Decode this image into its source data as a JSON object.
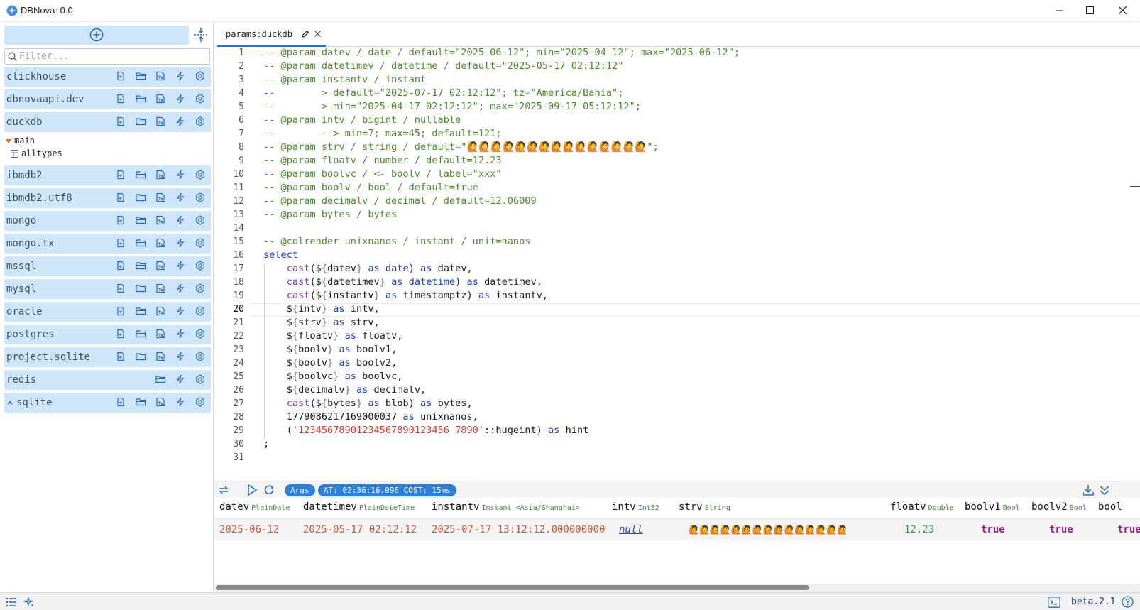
{
  "window": {
    "title": "DBNova: 0.0"
  },
  "sidebar": {
    "filter_placeholder": "Filter...",
    "connections": [
      {
        "label": "clickhouse"
      },
      {
        "label": "dbnovaapi.dev"
      },
      {
        "label": "duckdb"
      },
      {
        "label": "ibmdb2"
      },
      {
        "label": "ibmdb2.utf8"
      },
      {
        "label": "mongo"
      },
      {
        "label": "mongo.tx"
      },
      {
        "label": "mssql"
      },
      {
        "label": "mysql"
      },
      {
        "label": "oracle"
      },
      {
        "label": "postgres"
      },
      {
        "label": "project.sqlite"
      },
      {
        "label": "redis"
      },
      {
        "label": "sqlite"
      }
    ],
    "tree": {
      "schema": "main",
      "table": "alltypes"
    }
  },
  "tab": {
    "label": "params:duckdb"
  },
  "editor": {
    "active_line": 20,
    "lines": [
      "-- @param datev / date / default=\"2025-06-12\"; min=\"2025-04-12\"; max=\"2025-06-12\";",
      "-- @param datetimev / datetime / default=\"2025-05-17 02:12:12\"",
      "-- @param instantv / instant",
      "--        > default=\"2025-07-17 02:12:12\"; tz=\"America/Bahia\";",
      "--        > min=\"2025-04-17 02:12:12\"; max=\"2025-09-17 05:12:12\";",
      "-- @param intv / bigint / nullable",
      "--        - > min=7; max=45; default=121;",
      "-- @param strv / string / default=\"🙋🙋🙋🙋🙋🙋🙋🙋🙋🙋🙋🙋🙋🙋🙋\";",
      "-- @param floatv / number / default=12.23",
      "-- @param boolvc / <- boolv / label=\"xxx\"",
      "-- @param boolv / bool / default=true",
      "-- @param decimalv / decimal / default=12.06009",
      "-- @param bytes / bytes",
      "",
      "-- @colrender unixnanos / instant / unit=nanos",
      "select",
      "    cast(${datev} as date) as datev,",
      "    cast(${datetimev} as datetime) as datetimev,",
      "    cast(${instantv} as timestamptz) as instantv,",
      "    ${intv} as intv,",
      "    ${strv} as strv,",
      "    ${floatv} as floatv,",
      "    ${boolv} as boolv1,",
      "    ${boolv} as boolv2,",
      "    ${boolvc} as boolvc,",
      "    ${decimalv} as decimalv,",
      "    cast(${bytes} as blob) as bytes,",
      "    1779086217169000037 as unixnanos,",
      "    ('12345678901234567890123456 7890'::hugeint) as hint",
      ";",
      ""
    ]
  },
  "results": {
    "args_label": "Args",
    "status": "AT: 02:36:16.096 COST: 15ms",
    "columns": [
      {
        "name": "datev",
        "type": "PlainDate"
      },
      {
        "name": "datetimev",
        "type": "PlainDateTime"
      },
      {
        "name": "instantv",
        "type": "Instant <Asia/Shanghai>"
      },
      {
        "name": "intv",
        "type": "Int32"
      },
      {
        "name": "strv",
        "type": "String"
      },
      {
        "name": "floatv",
        "type": "Double"
      },
      {
        "name": "boolv1",
        "type": "Bool"
      },
      {
        "name": "boolv2",
        "type": "Bool"
      },
      {
        "name": "bool",
        "type": ""
      }
    ],
    "row": {
      "datev": "2025-06-12",
      "datetimev": "2025-05-17 02:12:12",
      "instantv": "2025-07-17 13:12:12.000000000",
      "intv": "null",
      "strv": "🙋🙋🙋🙋🙋🙋🙋🙋🙋🙋🙋🙋🙋🙋🙋",
      "floatv": "12.23",
      "boolv1": "true",
      "boolv2": "true",
      "boolvc": "true"
    }
  },
  "status_bar": {
    "version": "beta.2.1"
  },
  "colors": {
    "accent": "#2d7fd8",
    "sidebar_item_bg": "#cfe6fa"
  }
}
